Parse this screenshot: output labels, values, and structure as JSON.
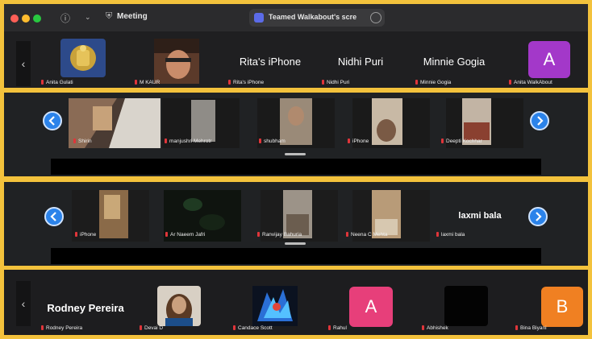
{
  "titlebar": {
    "meeting_label": "Meeting",
    "tab_title": "Teamed Walkabout's scre",
    "colors": {
      "close": "#ff5f57",
      "minimize": "#febc2e",
      "zoom": "#28c840"
    }
  },
  "row1": [
    {
      "label": "Anita Gulati"
    },
    {
      "label": "M KAUR"
    },
    {
      "name": "Rita's iPhone",
      "label": "Rita's iPhone"
    },
    {
      "name": "Nidhi Puri",
      "label": "Nidhi Puri"
    },
    {
      "name": "Minnie Gogia",
      "label": "Minnie Gogia"
    },
    {
      "letter": "A",
      "label": "Anita WalkAbout"
    }
  ],
  "strip1": [
    {
      "label": "Shirin"
    },
    {
      "label": "manjushri Mehrotr"
    },
    {
      "label": "shubham"
    },
    {
      "label": "iPhone"
    },
    {
      "label": "Deepti Kochhar"
    }
  ],
  "strip2": [
    {
      "label": "iPhone"
    },
    {
      "label": "Ar Naeem Jafri"
    },
    {
      "label": "Ranvijay Bahuria"
    },
    {
      "label": "Neena C Mehta"
    },
    {
      "name": "laxmi bala",
      "label": "laxmi bala"
    }
  ],
  "row4": [
    {
      "name": "Rodney Pereira",
      "label": "Rodney Pereira"
    },
    {
      "label": "Devai D"
    },
    {
      "label": "Candace Scott"
    },
    {
      "letter": "A",
      "label": "Rahul"
    },
    {
      "label": "Abhishek"
    },
    {
      "letter": "B",
      "label": "Bina Biyani"
    }
  ]
}
